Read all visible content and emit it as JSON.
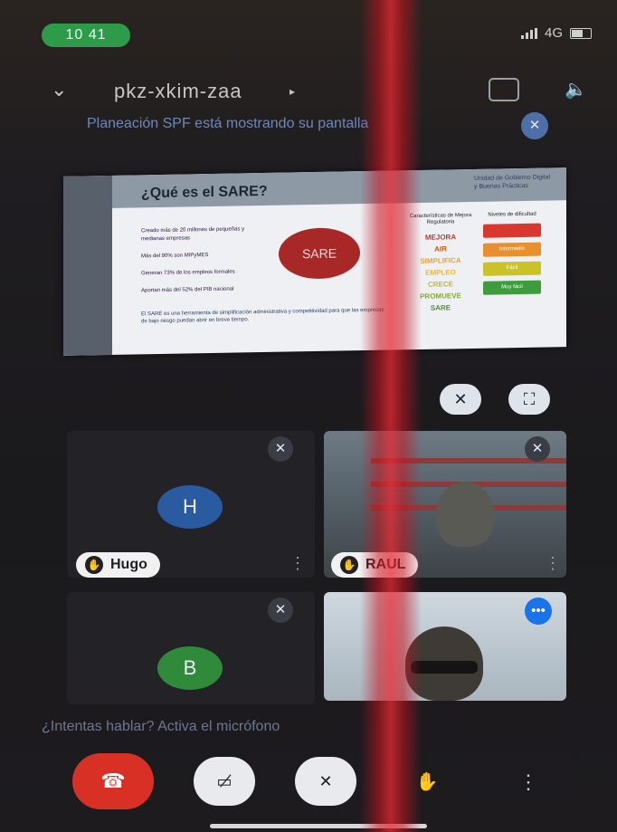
{
  "status": {
    "time": "10 41",
    "network": "4G"
  },
  "header": {
    "meeting_code": "pkz-xkim-zaa"
  },
  "presenting_message": "Planeación SPF está mostrando su pantalla",
  "slide": {
    "title": "¿Qué es el SARE?",
    "center_label": "SARE",
    "topright_text": "Unidad de Gobierno Digital y Buenas Prácticas",
    "bullets": [
      "Creado más de 20 millones de pequeñas y medianas empresas",
      "Más del 90% son MIPyMES",
      "Generan 73% de los empleos formales",
      "Aportan más del 52% del PIB nacional"
    ],
    "footer_text": "El SARE es una herramienta de simplificación administrativa y competitividad para que las empresas de bajo riesgo puedan abrir en breve tiempo.",
    "column_header": "Características de Mejora Regulatoria",
    "terms": [
      "MEJORA",
      "AIR",
      "SIMPLIFICA",
      "EMPLEO",
      "CRECE",
      "PROMUEVE",
      "SARE"
    ],
    "pill_header": "Niveles de dificultad",
    "pills": [
      "",
      "Intermedio",
      "Fácil",
      "Muy fácil"
    ]
  },
  "participants": [
    {
      "name": "Hugo",
      "initial": "H"
    },
    {
      "name": "RAUL",
      "initial": ""
    },
    {
      "name": "",
      "initial": "B"
    },
    {
      "name": "",
      "initial": ""
    }
  ],
  "mic_hint": "¿Intentas hablar? Activa el micrófono",
  "colors": {
    "avatar_h": "#2a5aa0",
    "avatar_b": "#2f8a3a",
    "end_call": "#d93025",
    "status_pill": "#2e9b4a"
  }
}
